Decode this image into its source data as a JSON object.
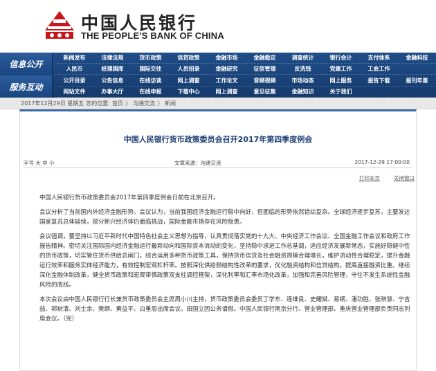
{
  "header": {
    "logo_cn": "中国人民银行",
    "logo_en": "THE PEOPLE'S BANK OF CHINA"
  },
  "nav": {
    "section1": "信息公开",
    "section2": "服务互动",
    "rows": [
      [
        "新闻发布",
        "法律法规",
        "货币政策",
        "信贷政策",
        "金融市场",
        "金融稳定",
        "调查统计",
        "银行会计",
        "支付体系",
        "金融科技"
      ],
      [
        "人民币",
        "经理国库",
        "国际交往",
        "人员招录",
        "金融研究",
        "征信管理",
        "反洗钱",
        "党建工作",
        "工会工作",
        ""
      ],
      [
        "公开目录",
        "公告信息",
        "在线访谈",
        "网上调查",
        "工作论文",
        "音频视频",
        "市场动态",
        "网上服务",
        "报告下载",
        "报刊年鉴"
      ],
      [
        "网站文件",
        "办事大厅",
        "在线申报",
        "下载中心",
        "网上调查",
        "意见征集",
        "金融知识",
        "关于我们",
        "",
        ""
      ]
    ]
  },
  "breadcrumb": {
    "date": "2017年12月29日 星期五",
    "label": "您的位置:",
    "home": "首页",
    "sep": "》",
    "level1": "沟通交流",
    "level2": "新闻"
  },
  "article": {
    "title": "中国人民银行货币政策委员会召开2017年第四季度例会",
    "font_size_label": "字号 大 中 小",
    "source": "文章来源：沟通交流",
    "date": "2017-12-29 17:00:00",
    "print": "打印本页",
    "close": "关闭窗口",
    "paragraphs": [
      "中国人民银行货币政策委员会2017年第四季度例会日前在北京召开。",
      "会议分析了当前国内外经济金融形势。会议认为，当前我国经济金融运行稳中向好，但面临的形势依然错综复杂。全球经济逐步复苏，主要发达国家复苏总体延续，部分新兴经济体仍面临挑战，国际金融市场存在风险隐患。",
      "会议强调，要坚持以习近平新时代中国特色社会主义思想为指导，认真贯彻落实党的十九大、中央经济工作会议、全国金融工作会议和政府工作报告精神。密切关注国际国内经济金融运行最新动向和国际资本流动的变化，坚持稳中求进工作总基调，适应经济发展新常态，实施好稳健中性的货币政策，切实管住货币供给总闸门，综合运用多种货币政策工具，保持货币信贷及社会融资规模合理增长，维护流动性合理稳定，提升金融运行效率和服务实体经济能力，有效控制宏观杠杆率。按照深化供给侧结构性改革的要求，优化融资结构和信贷结构，提高直接融资比重。继续深化金融体制改革，健全货币政策和宏观审慎政策双支柱调控框架，深化利率和汇率市场化改革，加强和完善风险管理，守住不发生系统性金融风险的底线。",
      "本次会议由中国人民银行行长兼货币政策委员会主席周小川主持，货币政策委员会委员丁学东、连维良、史耀斌、易纲、潘功胜、张晓慧、宁吉喆、郭树清、刘士余、樊纲、黄益平、白重恩出席会议。田国立因公务请假。中国人民银行南京分行、营业管理部、重庆营业管理部负责同志列席会议。（完）"
    ]
  }
}
